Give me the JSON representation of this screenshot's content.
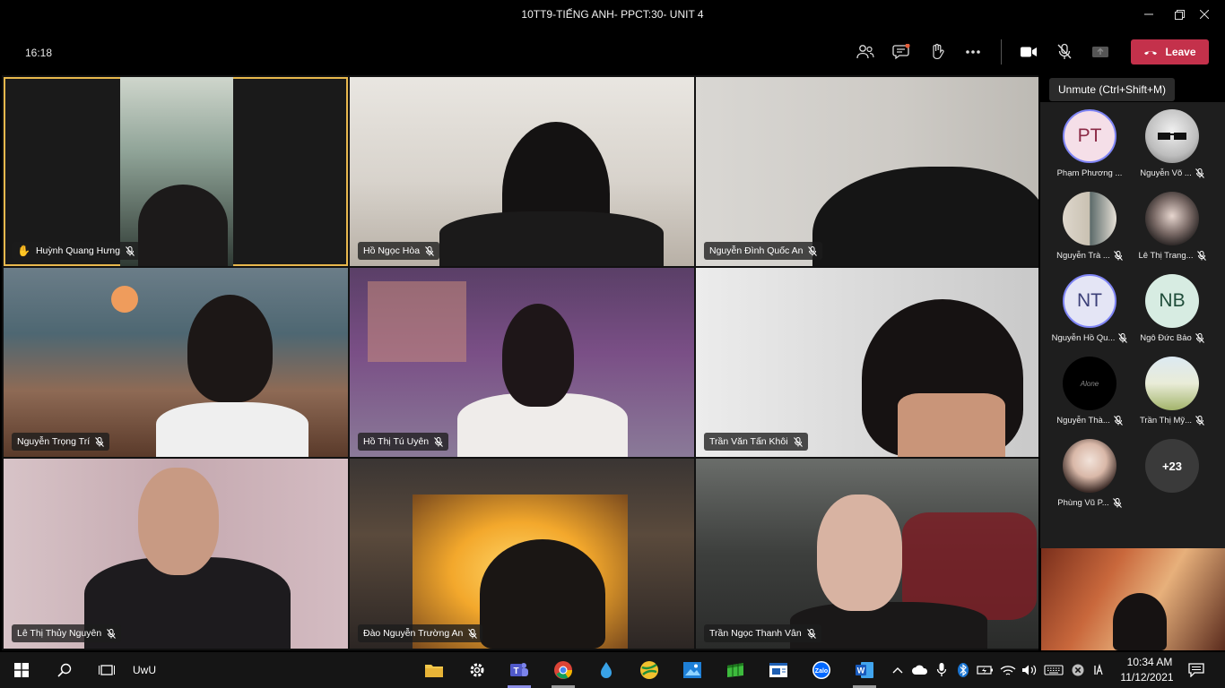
{
  "window": {
    "title": "10TT9-TIẾNG ANH- PPCT:30- UNIT 4"
  },
  "meeting": {
    "time": "16:18",
    "leave_label": "Leave",
    "tooltip": "Unmute (Ctrl+Shift+M)"
  },
  "participants": [
    {
      "name": "Huỳnh Quang Hưng",
      "hand_raised": true,
      "speaking": true
    },
    {
      "name": "Hồ Ngọc Hòa"
    },
    {
      "name": "Nguyễn Đình Quốc An"
    },
    {
      "name": "Nguyễn Trọng Trí"
    },
    {
      "name": "Hồ Thị Tú Uyên"
    },
    {
      "name": "Trần Văn Tấn Khôi"
    },
    {
      "name": "Lê Thị Thủy Nguyên"
    },
    {
      "name": "Đào Nguyễn Trường An"
    },
    {
      "name": "Trần Ngọc Thanh Vân"
    }
  ],
  "roster": [
    {
      "initials": "PT",
      "name": "Phạm Phương ..."
    },
    {
      "initials": "",
      "name": "Nguyễn Võ ..."
    },
    {
      "initials": "",
      "name": "Nguyễn Trà ..."
    },
    {
      "initials": "",
      "name": "Lê Thị Trang..."
    },
    {
      "initials": "NT",
      "name": "Nguyễn Hồ Qu..."
    },
    {
      "initials": "NB",
      "name": "Ngô Đức Bảo"
    },
    {
      "initials": "",
      "name": "Nguyễn Thà...",
      "avatar_text": "Alone"
    },
    {
      "initials": "",
      "name": "Trần Thị Mỹ..."
    },
    {
      "initials": "",
      "name": "Phùng Vũ P..."
    },
    {
      "initials": "+23",
      "name": ""
    }
  ],
  "taskbar": {
    "search_text": "UwU",
    "clock_time": "10:34 AM",
    "clock_date": "11/12/2021"
  },
  "colors": {
    "leave": "#c4314b",
    "speaking_border": "#e8b84d",
    "teams_purple": "#6264a7"
  }
}
